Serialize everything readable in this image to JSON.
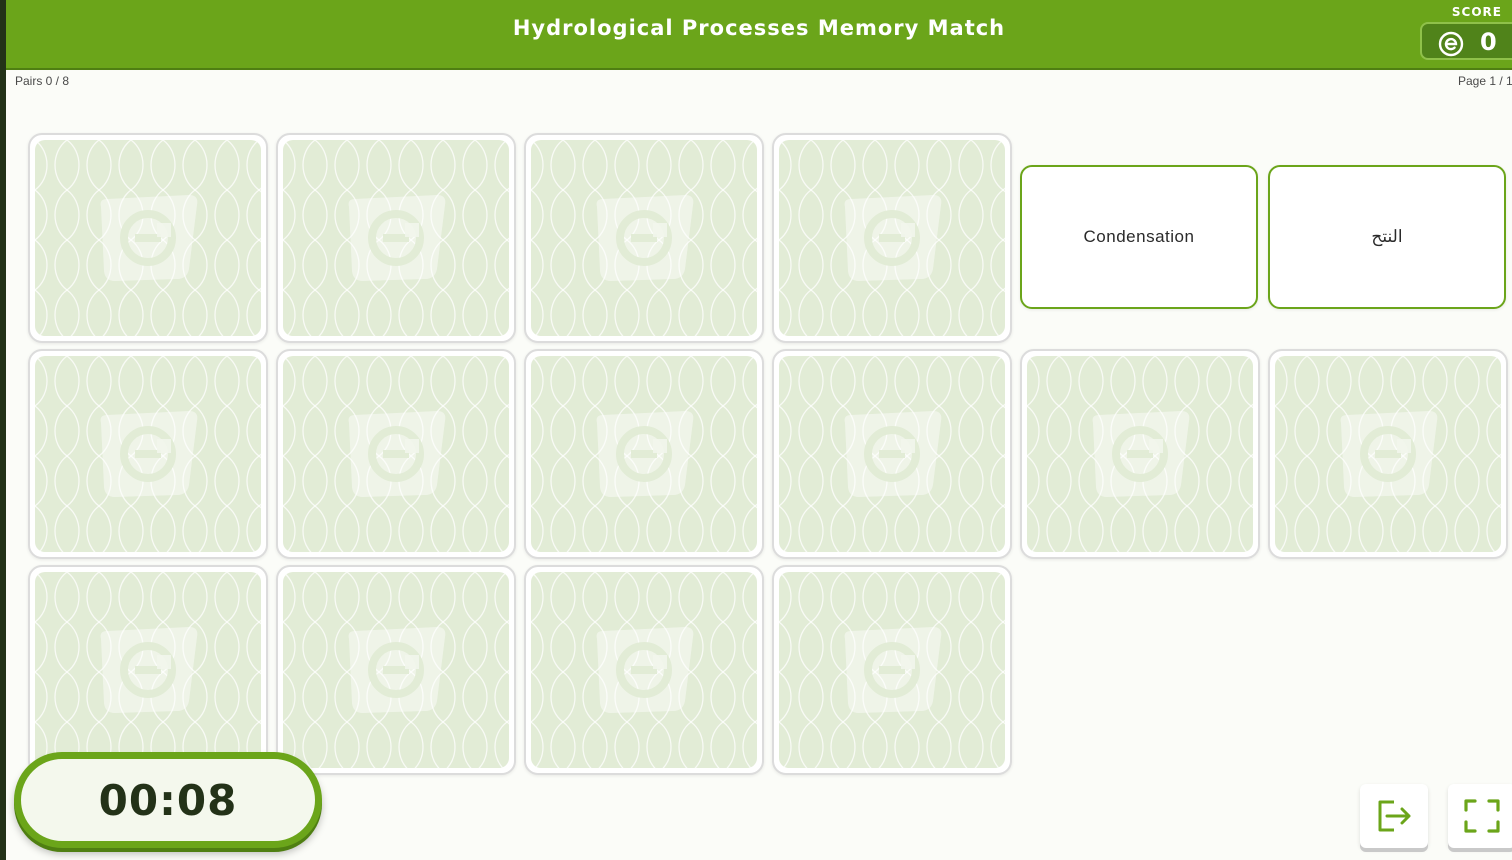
{
  "header": {
    "title": "Hydrological Processes Memory Match",
    "score_label": "SCORE",
    "score_value": "0",
    "score_icon": "e-coin-icon"
  },
  "status": {
    "pairs": "Pairs 0 / 8",
    "page": "Page 1 / 1"
  },
  "cards": [
    {
      "state": "face-down"
    },
    {
      "state": "face-down"
    },
    {
      "state": "face-down"
    },
    {
      "state": "face-down"
    },
    {
      "state": "face-up",
      "text": "Condensation"
    },
    {
      "state": "face-up",
      "text": "النتح"
    },
    {
      "state": "face-down"
    },
    {
      "state": "face-down"
    },
    {
      "state": "face-down"
    },
    {
      "state": "face-down"
    },
    {
      "state": "face-down"
    },
    {
      "state": "face-down"
    },
    {
      "state": "face-down"
    },
    {
      "state": "face-down"
    },
    {
      "state": "face-down"
    },
    {
      "state": "face-down"
    }
  ],
  "timer": {
    "value": "00:08"
  },
  "controls": {
    "exit_icon": "exit-icon",
    "fullscreen_icon": "fullscreen-icon"
  },
  "colors": {
    "accent": "#6ba51a",
    "accent_dark": "#4f7f12",
    "card_back": "#e2ecd6",
    "timer_text": "#233218"
  }
}
